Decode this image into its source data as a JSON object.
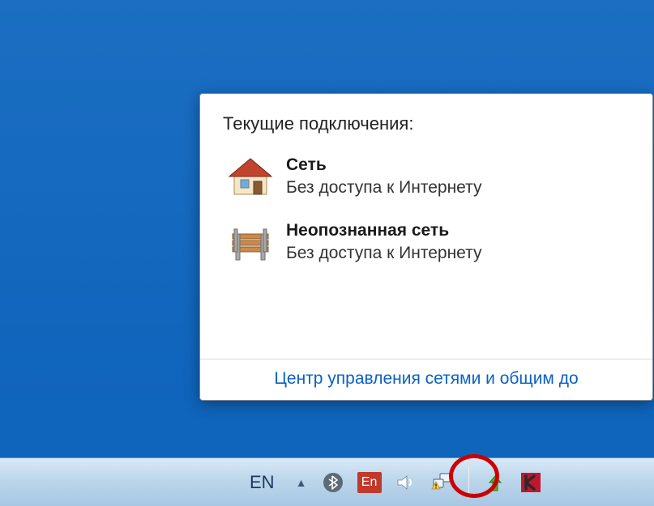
{
  "popup": {
    "title": "Текущие подключения:",
    "connections": [
      {
        "name": "Сеть",
        "status": "Без доступа к Интернету",
        "icon": "house-icon"
      },
      {
        "name": "Неопознанная сеть",
        "status": "Без доступа к Интернету",
        "icon": "bench-icon"
      }
    ],
    "link": "Центр управления сетями и общим до"
  },
  "taskbar": {
    "language": "EN",
    "punto_label": "En",
    "tray_icons": [
      "show-hidden-icons",
      "bluetooth-icon",
      "punto-switcher-icon",
      "volume-icon",
      "network-icon",
      "update-arrow-icon",
      "kaspersky-icon"
    ]
  },
  "colors": {
    "link": "#0b61c4",
    "highlight": "#c00"
  }
}
